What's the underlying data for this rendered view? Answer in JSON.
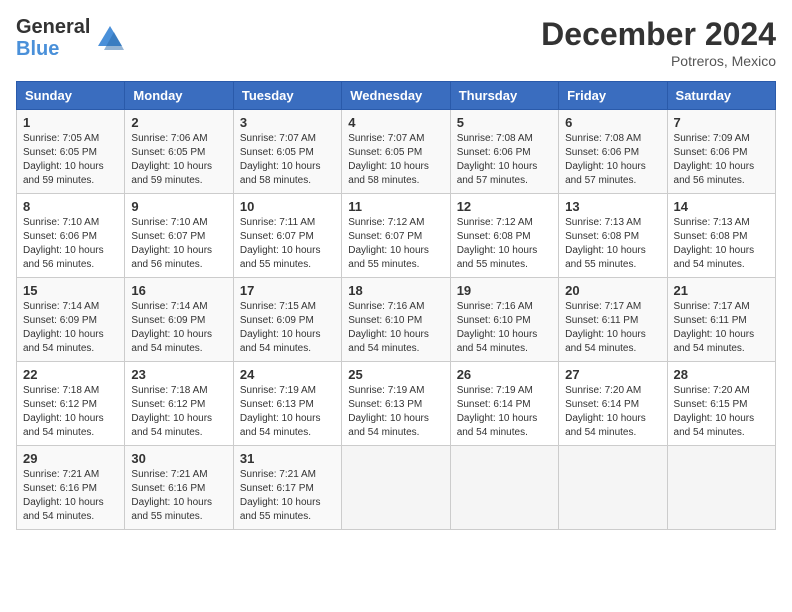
{
  "header": {
    "logo_general": "General",
    "logo_blue": "Blue",
    "month_year": "December 2024",
    "location": "Potreros, Mexico"
  },
  "days_of_week": [
    "Sunday",
    "Monday",
    "Tuesday",
    "Wednesday",
    "Thursday",
    "Friday",
    "Saturday"
  ],
  "weeks": [
    [
      {
        "day": "1",
        "info": "Sunrise: 7:05 AM\nSunset: 6:05 PM\nDaylight: 10 hours\nand 59 minutes."
      },
      {
        "day": "2",
        "info": "Sunrise: 7:06 AM\nSunset: 6:05 PM\nDaylight: 10 hours\nand 59 minutes."
      },
      {
        "day": "3",
        "info": "Sunrise: 7:07 AM\nSunset: 6:05 PM\nDaylight: 10 hours\nand 58 minutes."
      },
      {
        "day": "4",
        "info": "Sunrise: 7:07 AM\nSunset: 6:05 PM\nDaylight: 10 hours\nand 58 minutes."
      },
      {
        "day": "5",
        "info": "Sunrise: 7:08 AM\nSunset: 6:06 PM\nDaylight: 10 hours\nand 57 minutes."
      },
      {
        "day": "6",
        "info": "Sunrise: 7:08 AM\nSunset: 6:06 PM\nDaylight: 10 hours\nand 57 minutes."
      },
      {
        "day": "7",
        "info": "Sunrise: 7:09 AM\nSunset: 6:06 PM\nDaylight: 10 hours\nand 56 minutes."
      }
    ],
    [
      {
        "day": "8",
        "info": "Sunrise: 7:10 AM\nSunset: 6:06 PM\nDaylight: 10 hours\nand 56 minutes."
      },
      {
        "day": "9",
        "info": "Sunrise: 7:10 AM\nSunset: 6:07 PM\nDaylight: 10 hours\nand 56 minutes."
      },
      {
        "day": "10",
        "info": "Sunrise: 7:11 AM\nSunset: 6:07 PM\nDaylight: 10 hours\nand 55 minutes."
      },
      {
        "day": "11",
        "info": "Sunrise: 7:12 AM\nSunset: 6:07 PM\nDaylight: 10 hours\nand 55 minutes."
      },
      {
        "day": "12",
        "info": "Sunrise: 7:12 AM\nSunset: 6:08 PM\nDaylight: 10 hours\nand 55 minutes."
      },
      {
        "day": "13",
        "info": "Sunrise: 7:13 AM\nSunset: 6:08 PM\nDaylight: 10 hours\nand 55 minutes."
      },
      {
        "day": "14",
        "info": "Sunrise: 7:13 AM\nSunset: 6:08 PM\nDaylight: 10 hours\nand 54 minutes."
      }
    ],
    [
      {
        "day": "15",
        "info": "Sunrise: 7:14 AM\nSunset: 6:09 PM\nDaylight: 10 hours\nand 54 minutes."
      },
      {
        "day": "16",
        "info": "Sunrise: 7:14 AM\nSunset: 6:09 PM\nDaylight: 10 hours\nand 54 minutes."
      },
      {
        "day": "17",
        "info": "Sunrise: 7:15 AM\nSunset: 6:09 PM\nDaylight: 10 hours\nand 54 minutes."
      },
      {
        "day": "18",
        "info": "Sunrise: 7:16 AM\nSunset: 6:10 PM\nDaylight: 10 hours\nand 54 minutes."
      },
      {
        "day": "19",
        "info": "Sunrise: 7:16 AM\nSunset: 6:10 PM\nDaylight: 10 hours\nand 54 minutes."
      },
      {
        "day": "20",
        "info": "Sunrise: 7:17 AM\nSunset: 6:11 PM\nDaylight: 10 hours\nand 54 minutes."
      },
      {
        "day": "21",
        "info": "Sunrise: 7:17 AM\nSunset: 6:11 PM\nDaylight: 10 hours\nand 54 minutes."
      }
    ],
    [
      {
        "day": "22",
        "info": "Sunrise: 7:18 AM\nSunset: 6:12 PM\nDaylight: 10 hours\nand 54 minutes."
      },
      {
        "day": "23",
        "info": "Sunrise: 7:18 AM\nSunset: 6:12 PM\nDaylight: 10 hours\nand 54 minutes."
      },
      {
        "day": "24",
        "info": "Sunrise: 7:19 AM\nSunset: 6:13 PM\nDaylight: 10 hours\nand 54 minutes."
      },
      {
        "day": "25",
        "info": "Sunrise: 7:19 AM\nSunset: 6:13 PM\nDaylight: 10 hours\nand 54 minutes."
      },
      {
        "day": "26",
        "info": "Sunrise: 7:19 AM\nSunset: 6:14 PM\nDaylight: 10 hours\nand 54 minutes."
      },
      {
        "day": "27",
        "info": "Sunrise: 7:20 AM\nSunset: 6:14 PM\nDaylight: 10 hours\nand 54 minutes."
      },
      {
        "day": "28",
        "info": "Sunrise: 7:20 AM\nSunset: 6:15 PM\nDaylight: 10 hours\nand 54 minutes."
      }
    ],
    [
      {
        "day": "29",
        "info": "Sunrise: 7:21 AM\nSunset: 6:16 PM\nDaylight: 10 hours\nand 54 minutes."
      },
      {
        "day": "30",
        "info": "Sunrise: 7:21 AM\nSunset: 6:16 PM\nDaylight: 10 hours\nand 55 minutes."
      },
      {
        "day": "31",
        "info": "Sunrise: 7:21 AM\nSunset: 6:17 PM\nDaylight: 10 hours\nand 55 minutes."
      },
      {
        "day": "",
        "info": ""
      },
      {
        "day": "",
        "info": ""
      },
      {
        "day": "",
        "info": ""
      },
      {
        "day": "",
        "info": ""
      }
    ]
  ]
}
